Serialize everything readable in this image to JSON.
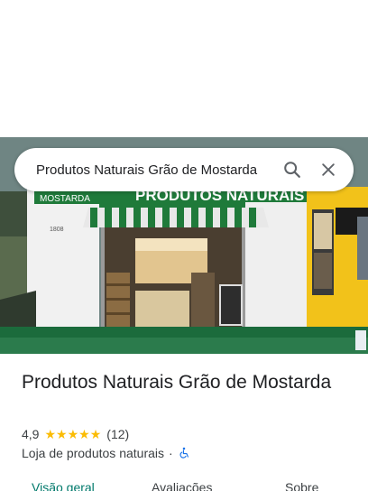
{
  "search": {
    "query": "Produtos Naturais Grão de Mostarda",
    "search_icon": "search-icon",
    "close_icon": "close-icon"
  },
  "photo": {
    "storefront_sign": "PRODUTOS NATURAIS",
    "side_sign": "MOSTARDA",
    "house_number": "1808"
  },
  "place": {
    "name": "Produtos Naturais Grão de Mostarda",
    "rating": "4,9",
    "stars": 5,
    "review_count": "(12)",
    "category": "Loja de produtos naturais",
    "separator": "·",
    "accessibility_icon": "wheelchair-icon"
  },
  "tabs": [
    {
      "label": "Visão geral",
      "active": true
    },
    {
      "label": "Avaliações",
      "active": false
    },
    {
      "label": "Sobre",
      "active": false
    }
  ],
  "colors": {
    "star": "#fbbc04",
    "active_tab": "#00796b",
    "accessibility_icon": "#1a73e8"
  }
}
